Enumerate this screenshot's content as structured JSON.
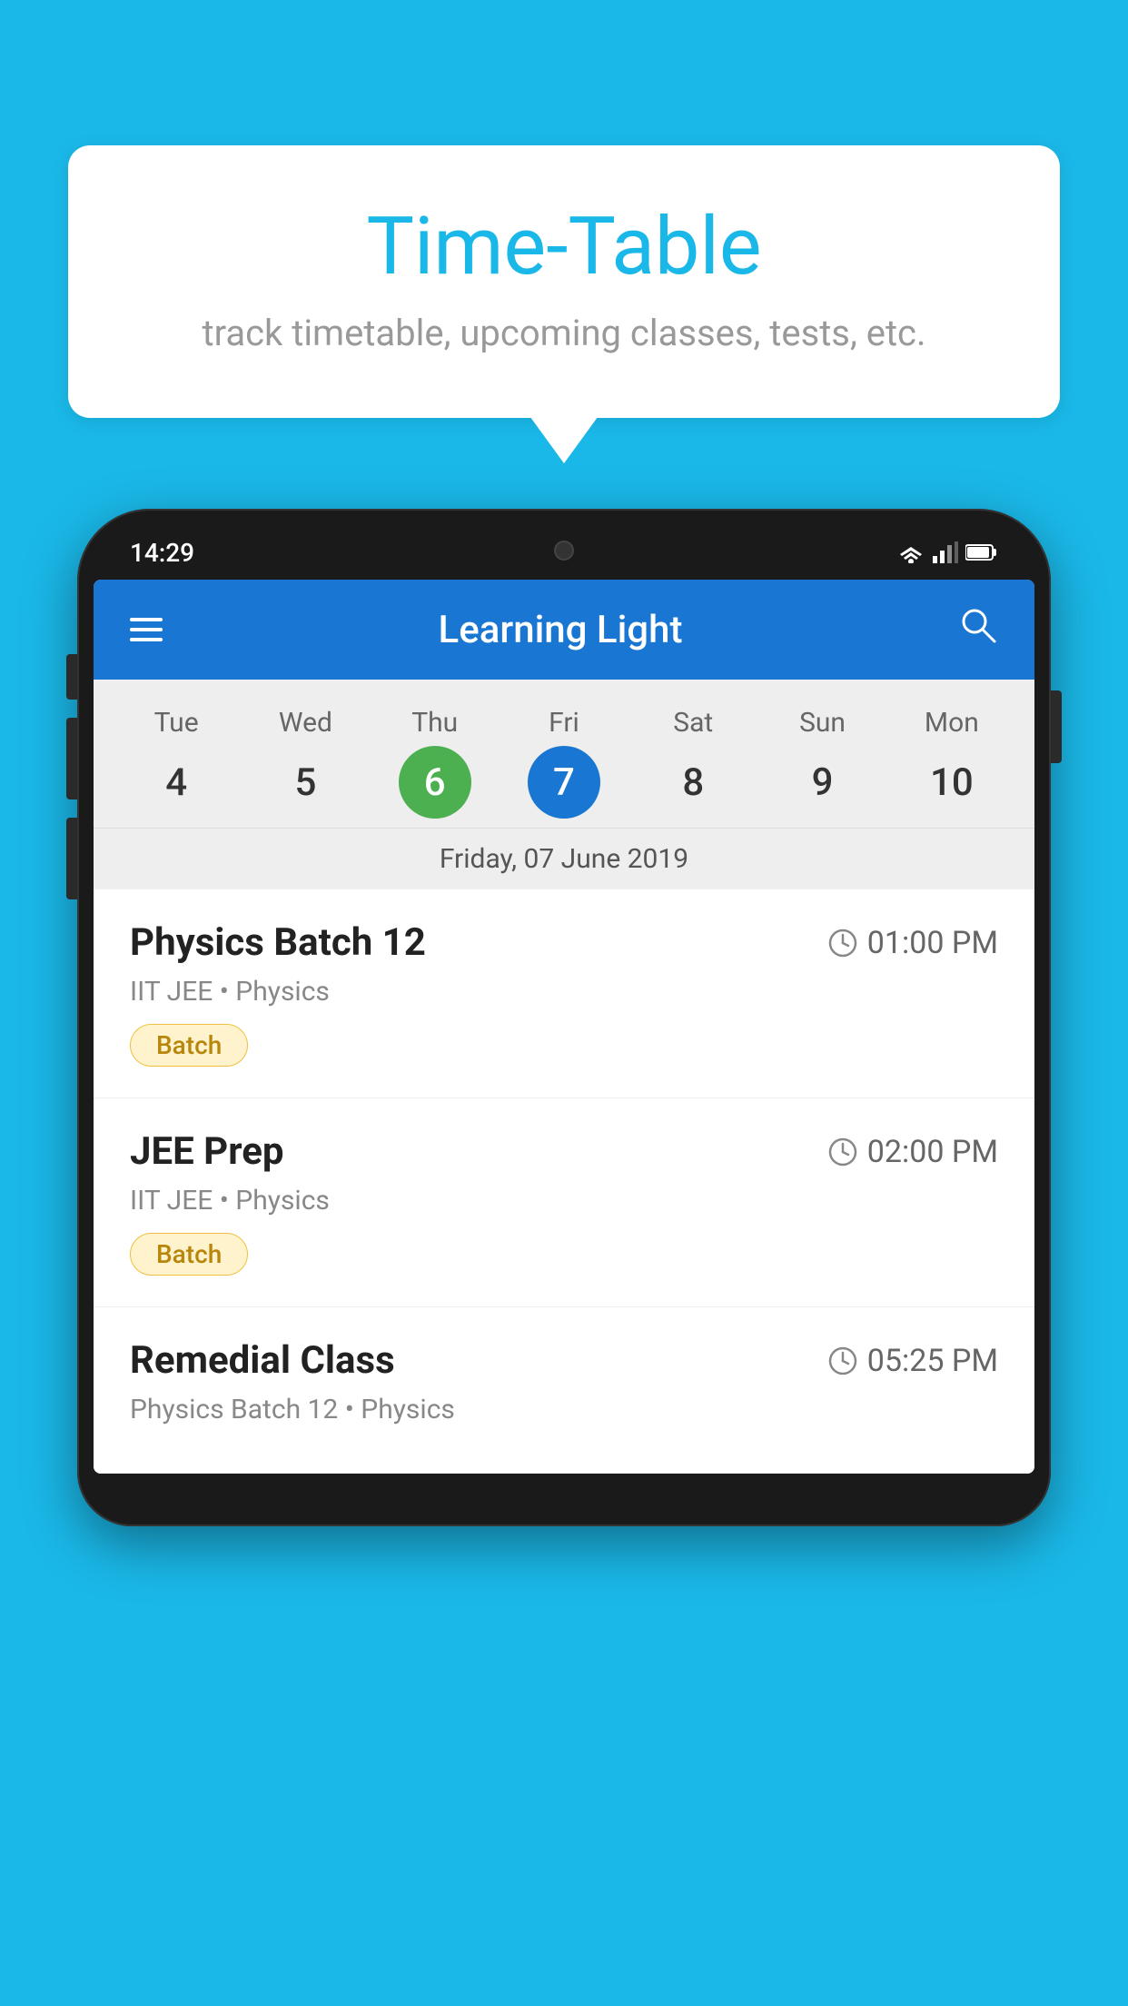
{
  "background_color": "#1AB8E8",
  "speech_bubble": {
    "title": "Time-Table",
    "subtitle": "track timetable, upcoming classes, tests, etc."
  },
  "phone": {
    "status_bar": {
      "time": "14:29"
    },
    "app_header": {
      "title": "Learning Light"
    },
    "calendar": {
      "weekdays": [
        "Tue",
        "Wed",
        "Thu",
        "Fri",
        "Sat",
        "Sun",
        "Mon"
      ],
      "dates": [
        "4",
        "5",
        "6",
        "7",
        "8",
        "9",
        "10"
      ],
      "today_index": 2,
      "selected_index": 3,
      "selected_date_label": "Friday, 07 June 2019"
    },
    "schedule": [
      {
        "title": "Physics Batch 12",
        "time": "01:00 PM",
        "subtitle": "IIT JEE • Physics",
        "badge": "Batch"
      },
      {
        "title": "JEE Prep",
        "time": "02:00 PM",
        "subtitle": "IIT JEE • Physics",
        "badge": "Batch"
      },
      {
        "title": "Remedial Class",
        "time": "05:25 PM",
        "subtitle": "Physics Batch 12 • Physics",
        "badge": null
      }
    ]
  },
  "icons": {
    "hamburger": "☰",
    "search": "🔍",
    "clock": "🕐"
  }
}
